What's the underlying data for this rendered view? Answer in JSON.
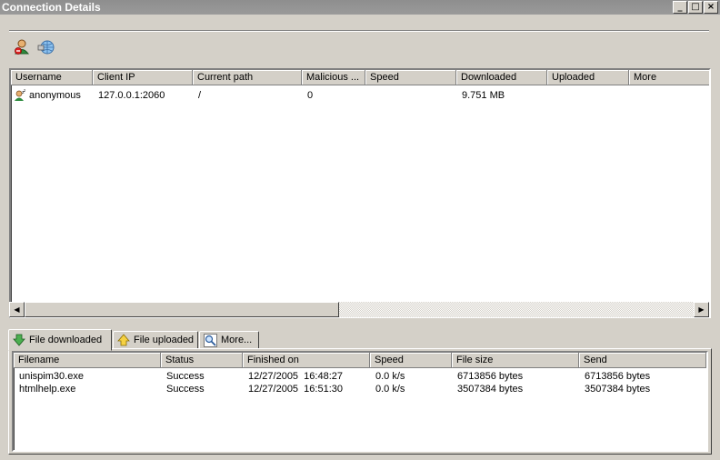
{
  "window": {
    "title": "Connection Details",
    "controls": [
      "_",
      "□",
      "×"
    ]
  },
  "toolbar": {
    "icons": [
      "disconnect-user-icon",
      "network-icon"
    ]
  },
  "connections": {
    "columns": [
      "Username",
      "Client IP",
      "Current path",
      "Malicious ...",
      "Speed",
      "Downloaded",
      "Uploaded",
      "More"
    ],
    "rows": [
      {
        "username": "anonymous",
        "client_ip": "127.0.0.1:2060",
        "current_path": "/",
        "malicious": "0",
        "speed": "",
        "downloaded": "9.751 MB",
        "uploaded": "",
        "more": ""
      }
    ]
  },
  "tabs": [
    {
      "label": "File downloaded",
      "icon": "download-arrow-icon",
      "active": true
    },
    {
      "label": "File uploaded",
      "icon": "upload-arrow-icon",
      "active": false
    },
    {
      "label": "More...",
      "icon": "magnifier-icon",
      "active": false
    }
  ],
  "transfers": {
    "columns": [
      "Filename",
      "Status",
      "Finished on",
      "Speed",
      "File size",
      "Send"
    ],
    "rows": [
      {
        "filename": "unispim30.exe",
        "status": "Success",
        "finished_on": "12/27/2005  16:48:27",
        "speed": "0.0 k/s",
        "file_size": "6713856 bytes",
        "send": "6713856 bytes"
      },
      {
        "filename": "htmlhelp.exe",
        "status": "Success",
        "finished_on": "12/27/2005  16:51:30",
        "speed": "0.0 k/s",
        "file_size": "3507384 bytes",
        "send": "3507384 bytes"
      }
    ]
  }
}
